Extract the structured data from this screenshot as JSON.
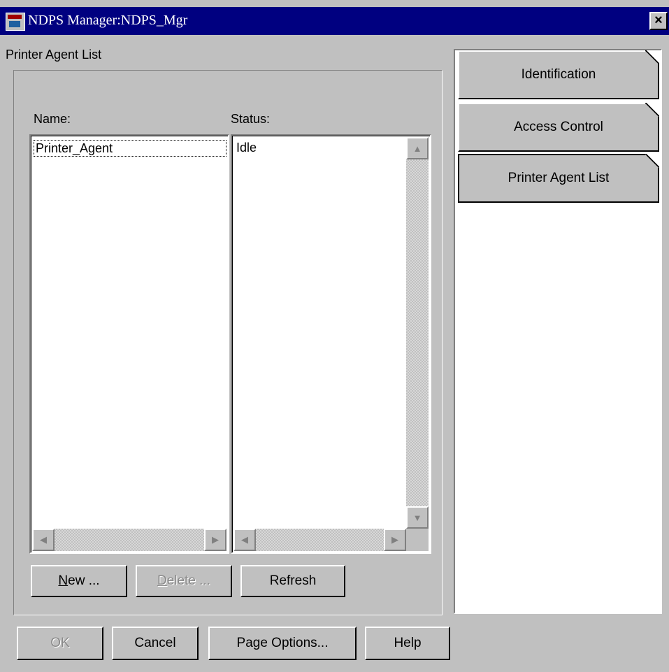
{
  "window": {
    "title": "NDPS Manager:NDPS_Mgr",
    "close_glyph": "×"
  },
  "section_label": "Printer Agent List",
  "columns": {
    "name_header": "Name:",
    "status_header": "Status:"
  },
  "agents": [
    {
      "name": "Printer_Agent",
      "status": "Idle"
    }
  ],
  "list_buttons": {
    "new": {
      "mnemonic": "N",
      "rest": "ew ..."
    },
    "delete": {
      "mnemonic": "D",
      "rest": "elete ..."
    },
    "refresh": "Refresh"
  },
  "dialog_buttons": {
    "ok": "OK",
    "cancel": "Cancel",
    "page_options": "Page Options...",
    "help": "Help"
  },
  "page_tabs": [
    {
      "label": "Identification",
      "active": false
    },
    {
      "label": "Access Control",
      "active": false
    },
    {
      "label": "Printer Agent List",
      "active": true
    }
  ],
  "icons": {
    "scroll_up": "up-arrow-icon",
    "scroll_down": "down-arrow-icon",
    "scroll_left": "left-arrow-icon",
    "scroll_right": "right-arrow-icon"
  }
}
